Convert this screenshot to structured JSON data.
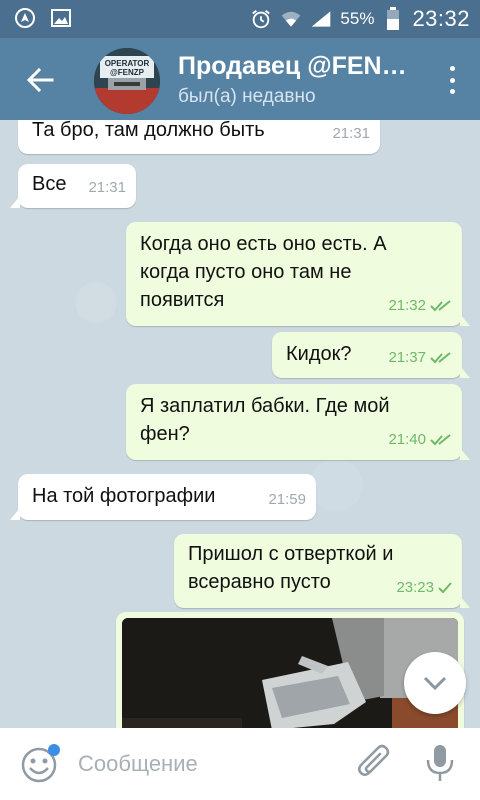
{
  "status_bar": {
    "battery_percent": "55%",
    "time": "23:32",
    "icons": [
      "nav-icon",
      "image-icon",
      "alarm-icon",
      "wifi-icon",
      "signal-icon",
      "battery-icon"
    ]
  },
  "header": {
    "title": "Продавец @FEN…",
    "subtitle": "был(а) недавно",
    "avatar_text_line1": "OPERATOR",
    "avatar_text_line2": "@FENZP",
    "icons": [
      "back-arrow-icon",
      "more-vert-icon"
    ]
  },
  "messages": [
    {
      "direction": "in",
      "text": "Та бро, там должно быть",
      "time": "21:31"
    },
    {
      "direction": "in",
      "text": "Все",
      "time": "21:31"
    },
    {
      "direction": "out",
      "text": "Когда оно есть оно есть. А когда пусто оно там не появится",
      "time": "21:32",
      "status": "read"
    },
    {
      "direction": "out",
      "text": "Кидок?",
      "time": "21:37",
      "status": "read"
    },
    {
      "direction": "out",
      "text": "Я заплатил бабки. Где мой фен?",
      "time": "21:40",
      "status": "read"
    },
    {
      "direction": "in",
      "text": "На той фотографии",
      "time": "21:59"
    },
    {
      "direction": "out",
      "text": "Пришол с отверткой и всеравно пусто",
      "time": "23:23",
      "status": "sent"
    },
    {
      "direction": "out",
      "type": "photo"
    }
  ],
  "composer": {
    "placeholder": "Сообщение",
    "icons": [
      "emoji-icon",
      "attach-icon",
      "mic-icon",
      "chevron-down-icon"
    ]
  },
  "colors": {
    "status_bar": "#4b6f8e",
    "header": "#5682a3",
    "chat_background": "#cdd9e1",
    "incoming_bubble": "#ffffff",
    "outgoing_bubble": "#effdde",
    "check_color": "#6fb86a",
    "badge_dot": "#3b8ee8"
  }
}
